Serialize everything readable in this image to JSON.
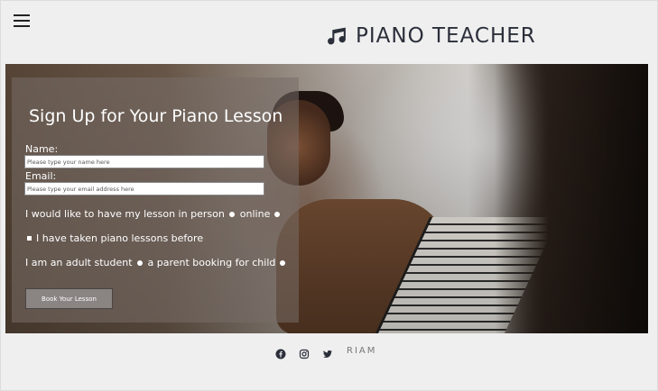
{
  "header": {
    "brand_title": "PIANO TEACHER",
    "menu_icon": "hamburger-menu-icon",
    "brand_icon": "music-note-icon"
  },
  "form": {
    "title": "Sign Up for Your Piano Lesson",
    "name_label": "Name:",
    "name_placeholder": "Please type your name here",
    "email_label": "Email:",
    "email_placeholder": "Please type your email address here",
    "lesson_text": "I would like to have my lesson in person",
    "lesson_option_online": "online",
    "experience_text": "I have taken piano lessons before",
    "student_text": "I am an adult student",
    "student_option_parent": "a parent booking for child",
    "submit_label": "Book Your Lesson"
  },
  "footer": {
    "social_icons": [
      "facebook-icon",
      "instagram-icon",
      "twitter-icon"
    ],
    "credit": "RIAM"
  },
  "colors": {
    "background": "#efefef",
    "brand_text": "#2b2f3a",
    "panel_overlay": "#786e68",
    "button": "#8a8482"
  }
}
